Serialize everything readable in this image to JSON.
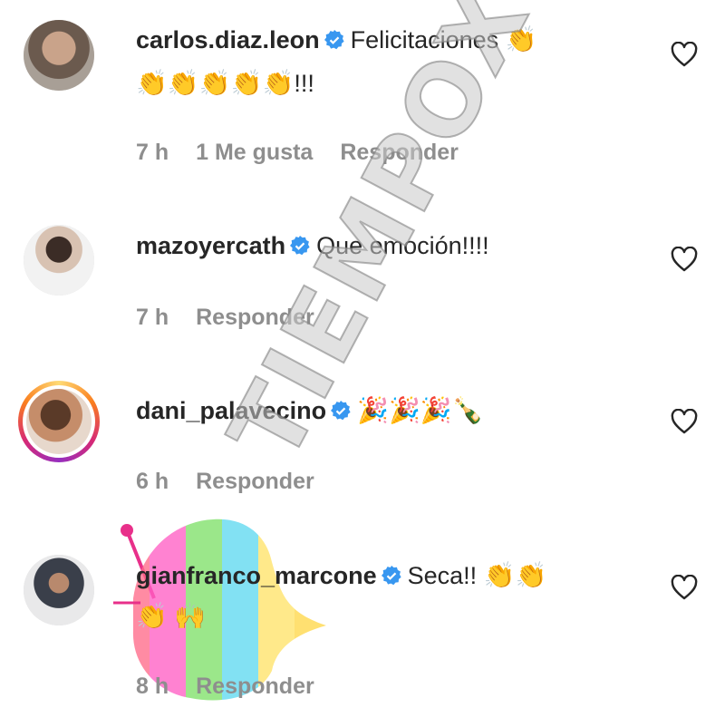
{
  "comments": [
    {
      "username": "carlos.diaz.leon",
      "text": "Felicitaciones",
      "emoji_line1": "👏",
      "emoji_line2": "👏👏👏👏👏",
      "suffix": "!!!",
      "time": "7 h",
      "likes": "1 Me gusta",
      "reply_label": "Responder"
    },
    {
      "username": "mazoyercath",
      "text": "Que emoción!!!!",
      "time": "7 h",
      "reply_label": "Responder"
    },
    {
      "username": "dani_palavecino",
      "emojis": "🎉🎉🎉🍾",
      "time": "6 h",
      "reply_label": "Responder"
    },
    {
      "username": "gianfranco_marcone",
      "text": "Seca!!",
      "emoji_line1": "👏👏",
      "emoji_line2_a": "👏",
      "emoji_line2_b": "🙌",
      "time": "8 h",
      "reply_label": "Responder"
    }
  ],
  "watermark": "TIEMPOX",
  "icons": {
    "verified": "verified-badge-icon",
    "like": "heart-outline-icon"
  },
  "colors": {
    "verified_blue": "#3897f0",
    "meta_gray": "#8e8e8e",
    "text": "#262626"
  }
}
